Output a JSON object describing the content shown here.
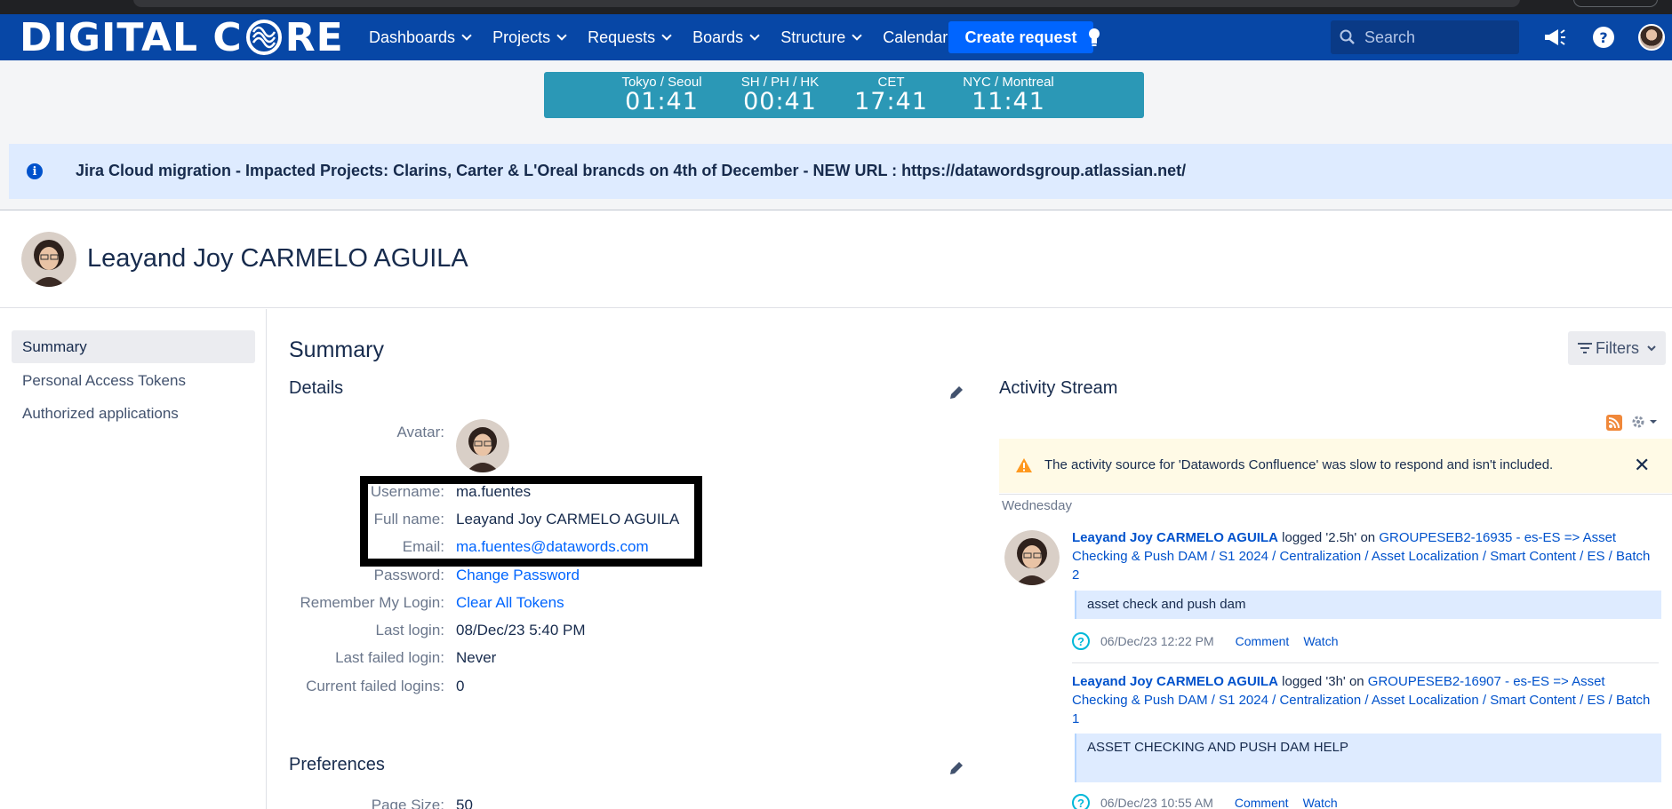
{
  "nav": {
    "logo_left": "DIGITAL C",
    "logo_right": "RE",
    "items": [
      {
        "label": "Dashboards",
        "dropdown": true
      },
      {
        "label": "Projects",
        "dropdown": true
      },
      {
        "label": "Requests",
        "dropdown": true
      },
      {
        "label": "Boards",
        "dropdown": true
      },
      {
        "label": "Structure",
        "dropdown": true
      },
      {
        "label": "Calendar",
        "dropdown": false
      }
    ],
    "create_label": "Create request",
    "search_placeholder": "Search",
    "icons": [
      "lightbulb-icon",
      "megaphone-icon",
      "help-icon",
      "user-avatar"
    ]
  },
  "clocks": [
    {
      "label": "Tokyo / Seoul",
      "time": "01:41"
    },
    {
      "label": "SH / PH / HK",
      "time": "00:41"
    },
    {
      "label": "CET",
      "time": "17:41"
    },
    {
      "label": "NYC / Montreal",
      "time": "11:41"
    }
  ],
  "banner": {
    "text": "Jira Cloud migration - Impacted Projects: Clarins, Carter & L'Oreal brancds on 4th of December - NEW URL : https://datawordsgroup.atlassian.net/"
  },
  "profile": {
    "name": "Leayand Joy CARMELO AGUILA"
  },
  "sidebar": {
    "items": [
      {
        "label": "Summary",
        "active": true
      },
      {
        "label": "Personal Access Tokens",
        "active": false
      },
      {
        "label": "Authorized applications",
        "active": false
      }
    ]
  },
  "main": {
    "title": "Summary",
    "filters_label": "Filters",
    "details_title": "Details",
    "preferences_title": "Preferences",
    "details": {
      "avatar_label": "Avatar:",
      "username_label": "Username:",
      "username": "ma.fuentes",
      "fullname_label": "Full name:",
      "fullname": "Leayand Joy CARMELO AGUILA",
      "email_label": "Email:",
      "email": "ma.fuentes@datawords.com",
      "password_label": "Password:",
      "password_link": "Change Password",
      "remember_label": "Remember My Login:",
      "remember_link": "Clear All Tokens",
      "last_login_label": "Last login:",
      "last_login": "08/Dec/23 5:40 PM",
      "last_failed_label": "Last failed login:",
      "last_failed": "Never",
      "current_failed_label": "Current failed logins:",
      "current_failed": "0"
    },
    "prefs": {
      "page_size_label": "Page Size:",
      "page_size": "50"
    }
  },
  "activity": {
    "title": "Activity Stream",
    "warning": "The activity source for 'Datawords Confluence' was slow to respond and isn't included.",
    "day": "Wednesday",
    "entries": [
      {
        "user": "Leayand Joy CARMELO AGUILA",
        "action": " logged '2.5h' on ",
        "issue": "GROUPESEB2-16935 - es-ES => Asset Checking & Push DAM / S1 2024 / Centralization / Asset Localization / Smart Content / ES / Batch 2",
        "comment": "asset check and push dam",
        "time": "06/Dec/23 12:22 PM",
        "comment_link": "Comment",
        "watch_link": "Watch"
      },
      {
        "user": "Leayand Joy CARMELO AGUILA",
        "action": " logged '3h' on ",
        "issue": "GROUPESEB2-16907 - es-ES => Asset Checking & Push DAM / S1 2024 / Centralization / Asset Localization / Smart Content / ES / Batch 1",
        "comment": "ASSET CHECKING AND PUSH DAM HELP",
        "time": "06/Dec/23 10:55 AM",
        "comment_link": "Comment",
        "watch_link": "Watch"
      }
    ]
  },
  "colors": {
    "nav_bg": "#0747a6",
    "create_btn": "#0065ff",
    "clock_bg": "#2b98b6",
    "banner_bg": "#deebff",
    "warning_bg": "#fffae6",
    "link": "#0065ff"
  }
}
